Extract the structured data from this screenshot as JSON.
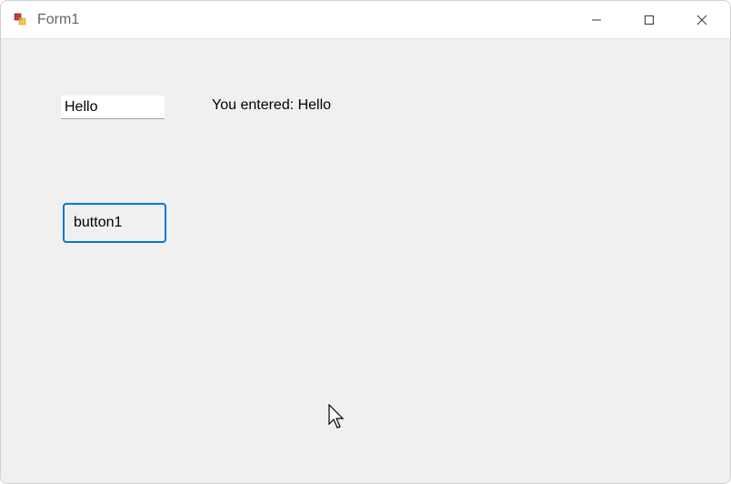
{
  "window": {
    "title": "Form1"
  },
  "form": {
    "textbox_value": "Hello",
    "output_label": "You entered: Hello",
    "button_label": "button1"
  }
}
